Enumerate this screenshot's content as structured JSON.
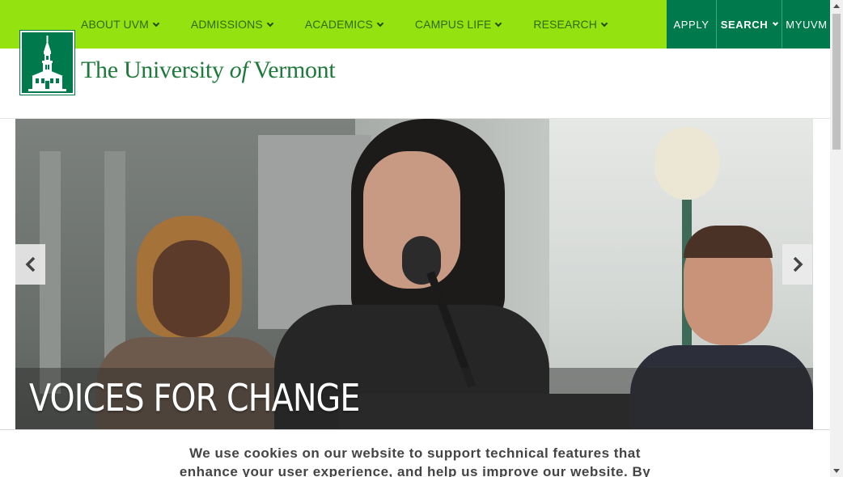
{
  "nav": {
    "items": [
      {
        "label": "ABOUT UVM"
      },
      {
        "label": "ADMISSIONS"
      },
      {
        "label": "ACADEMICS"
      },
      {
        "label": "CAMPUS LIFE"
      },
      {
        "label": "RESEARCH"
      }
    ],
    "utility": {
      "apply": "APPLY",
      "search": "SEARCH",
      "myuvm": "MYUVM"
    }
  },
  "brand": {
    "name_prefix": "The University ",
    "name_of": "of",
    "name_suffix": " Vermont"
  },
  "hero": {
    "caption": "VOICES FOR CHANGE",
    "prev_icon": "chevron-left-icon",
    "next_icon": "chevron-right-icon"
  },
  "cookie": {
    "line1": "We use cookies on our website to support technical features that",
    "line2": "enhance your user experience, and help us improve our website. By"
  },
  "colors": {
    "nav_green": "#94e20f",
    "uvm_green": "#007a4d",
    "wordmark_green": "#1e7a3b"
  }
}
